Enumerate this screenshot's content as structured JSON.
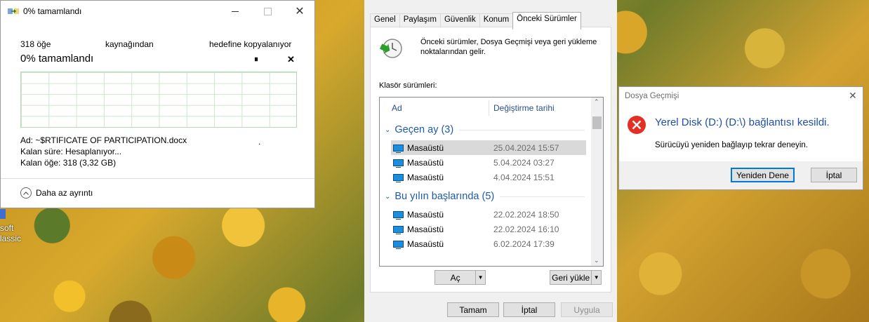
{
  "copy_dialog": {
    "title": "0% tamamlandı",
    "items_text": "318 öğe",
    "source_text": "kaynağından",
    "dest_text": "hedefine kopyalanıyor",
    "percent_heading": "0%  tamamlandı",
    "progress_fraction": 0,
    "pause_glyph": "⏸",
    "cancel_glyph": "✕",
    "name_label": "Ad:",
    "name_value": "~$RTIFICATE OF PARTICIPATION.docx",
    "time_label": "Kalan süre:",
    "time_value": "Hesaplanıyor...",
    "items_label": "Kalan öğe:",
    "items_value": "318 (3,32 GB)",
    "dot": ".",
    "less_details": "Daha az ayrıntı"
  },
  "props_dialog": {
    "tabs": [
      "Genel",
      "Paylaşım",
      "Güvenlik",
      "Konum",
      "Önceki Sürümler"
    ],
    "description": "Önceki sürümler, Dosya Geçmişi veya geri yükleme noktalarından gelir.",
    "folder_versions_label": "Klasör sürümleri:",
    "col_name": "Ad",
    "col_date": "Değiştirme tarihi",
    "groups": [
      {
        "title": "Geçen ay (3)",
        "rows": [
          {
            "name": "Masaüstü",
            "date": "25.04.2024 15:57",
            "selected": true
          },
          {
            "name": "Masaüstü",
            "date": "5.04.2024 03:27",
            "selected": false
          },
          {
            "name": "Masaüstü",
            "date": "4.04.2024 15:51",
            "selected": false
          }
        ]
      },
      {
        "title": "Bu yılın başlarında (5)",
        "rows": [
          {
            "name": "Masaüstü",
            "date": "22.02.2024 18:50",
            "selected": false
          },
          {
            "name": "Masaüstü",
            "date": "22.02.2024 16:10",
            "selected": false
          },
          {
            "name": "Masaüstü",
            "date": "6.02.2024 17:39",
            "selected": false
          }
        ]
      }
    ],
    "open_btn": "Aç",
    "restore_btn": "Geri yükle",
    "ok_btn": "Tamam",
    "cancel_btn": "İptal",
    "apply_btn": "Uygula"
  },
  "error_dialog": {
    "title": "Dosya Geçmişi",
    "heading": "Yerel Disk (D:) (D:\\) bağlantısı kesildi.",
    "message": "Sürücüyü yeniden bağlayıp tekrar deneyin.",
    "retry_btn": "Yeniden Dene",
    "cancel_btn": "İptal"
  },
  "desktop": {
    "icon_label_line1": "soft",
    "icon_label_line2": "lassic"
  }
}
